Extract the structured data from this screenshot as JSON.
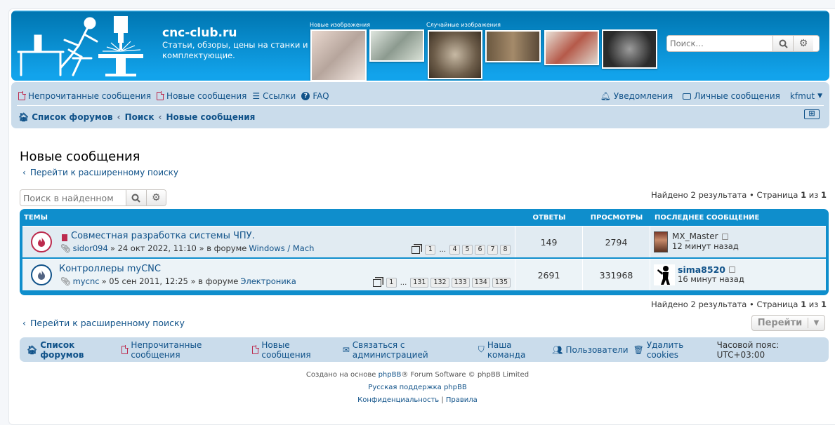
{
  "header": {
    "site_title": "cnc-club.ru",
    "site_desc": "Статьи, обзоры, цены на станки и комплектующие.",
    "gallery_new_label": "Новые изображения",
    "gallery_random_label": "Случайные изображения",
    "search_placeholder": "Поиск…"
  },
  "navbar": {
    "unread": "Непрочитанные сообщения",
    "new_posts": "Новые сообщения",
    "links": "Ссылки",
    "faq": "FAQ",
    "notifications": "Уведомления",
    "private_messages": "Личные сообщения",
    "username": "kfmut",
    "breadcrumb": [
      "Список форумов",
      "Поиск",
      "Новые сообщения"
    ]
  },
  "page": {
    "title": "Новые сообщения",
    "advanced_search": "Перейти к расширенному поиску",
    "search_results_placeholder": "Поиск в найденном",
    "results_text_pre": "Найдено 2 результата • Страница ",
    "page_num": "1",
    "results_text_mid": " из ",
    "page_total": "1",
    "goto_label": "Перейти"
  },
  "table": {
    "headers": {
      "topics": "ТЕМЫ",
      "replies": "ОТВЕТЫ",
      "views": "ПРОСМОТРЫ",
      "last_post": "ПОСЛЕДНЕЕ СООБЩЕНИЕ"
    },
    "rows": [
      {
        "title": "Совместная разработка системы ЧПУ.",
        "author": "sidor094",
        "date": "» 24 окт 2022, 11:10 » в форуме",
        "forum": "Windows / Mach",
        "pages": [
          "1",
          "...",
          "4",
          "5",
          "6",
          "7",
          "8"
        ],
        "replies": "149",
        "views": "2794",
        "last_author": "MX_Master",
        "last_time": "12 минут назад",
        "hot": true
      },
      {
        "title": "Контроллеры myCNC",
        "author": "mycnc",
        "date": "» 05 сен 2011, 12:25 » в форуме",
        "forum": "Электроника",
        "pages": [
          "1",
          "...",
          "131",
          "132",
          "133",
          "134",
          "135"
        ],
        "replies": "2691",
        "views": "331968",
        "last_author": "sima8520",
        "last_time": "16 минут назад",
        "hot": false
      }
    ]
  },
  "footer_nav": {
    "index": "Список форумов",
    "unread": "Непрочитанные сообщения",
    "new_posts": "Новые сообщения",
    "contact": "Связаться с администрацией",
    "team": "Наша команда",
    "members": "Пользователи",
    "delete_cookies": "Удалить cookies",
    "timezone": "Часовой пояс: UTC+03:00"
  },
  "copyright": {
    "line1_pre": "Создано на основе ",
    "phpbb": "phpBB",
    "line1_post": "® Forum Software © phpBB Limited",
    "line2": "Русская поддержка phpBB",
    "privacy": "Конфиденциальность",
    "sep": " | ",
    "terms": "Правила"
  },
  "colors": {
    "brand_blue": "#12a3eb",
    "link": "#105289",
    "nav_bg": "#cadceb",
    "hot_icon": "#bc2a4d"
  }
}
